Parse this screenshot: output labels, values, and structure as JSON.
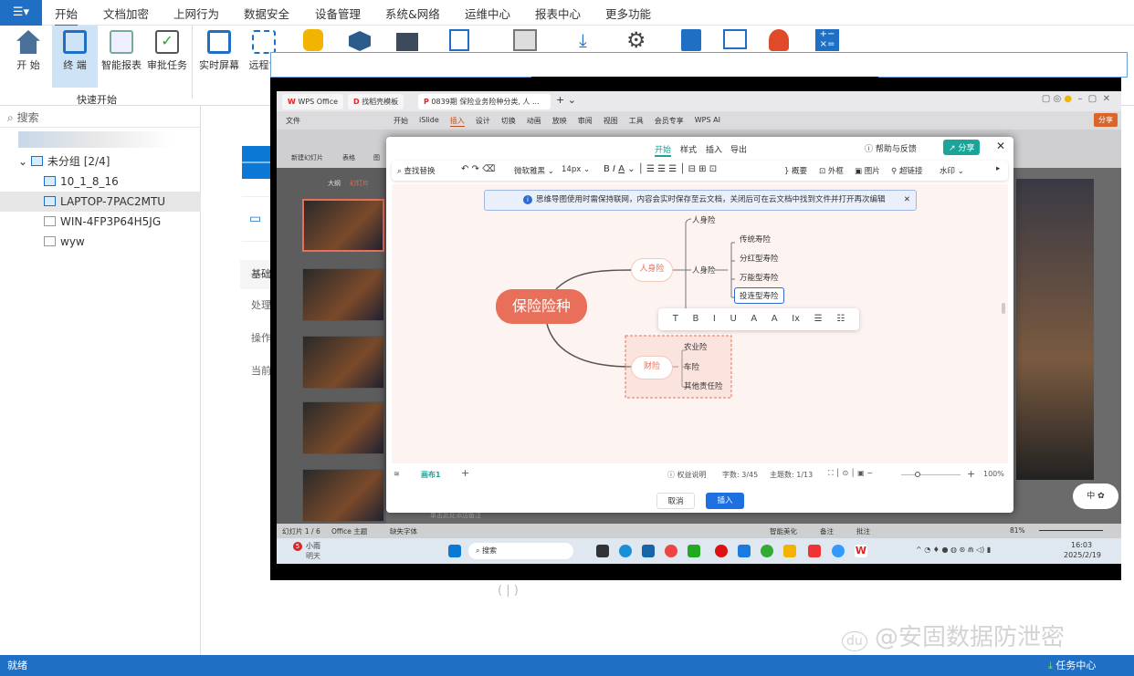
{
  "menubar": {
    "app_icon": "app-menu-icon",
    "items": [
      "开始",
      "文档加密",
      "上网行为",
      "数据安全",
      "设备管理",
      "系统&网络",
      "运维中心",
      "报表中心",
      "更多功能"
    ],
    "active": "开始"
  },
  "ribbon": {
    "buttons": [
      "开 始",
      "终 端",
      "智能报表",
      "审批任务",
      "实时屏幕",
      "远程协"
    ],
    "group_label": "快速开始"
  },
  "sidebar": {
    "search_placeholder": "搜索",
    "group": "未分组",
    "group_count": "[2/4]",
    "devices": [
      "10_1_8_16",
      "LAPTOP-7PAC2MTU",
      "WIN-4FP3P64H5JG",
      "wyw"
    ],
    "selected": "LAPTOP-7PAC2MTU"
  },
  "main_partial": {
    "labels": [
      "基础",
      "处理",
      "操作",
      "当前"
    ]
  },
  "wps": {
    "tabs": [
      "WPS Office",
      "找稻壳模板",
      "0839期 保险业务险种分类, 人 ..."
    ],
    "menu": [
      "文件",
      "开始",
      "iSlide",
      "插入",
      "设计",
      "切换",
      "动画",
      "放映",
      "审阅",
      "视图",
      "工具",
      "会员专享",
      "WPS AI"
    ],
    "active_menu": "插入",
    "share": "分享",
    "tool": [
      "新建幻灯片",
      "表格",
      "图"
    ],
    "pane_tabs": [
      "大纲",
      "幻灯片"
    ],
    "status_left": [
      "幻灯片 1 / 6",
      "Office 主题",
      "缺失字体"
    ],
    "status_right": [
      "智能美化",
      "备注",
      "批注",
      "81%"
    ],
    "note_hint": "单击此处添加备注"
  },
  "dialog": {
    "tabs": [
      "开始",
      "样式",
      "插入",
      "导出"
    ],
    "active_tab": "开始",
    "help": "帮助与反馈",
    "share": "分享",
    "toolbar": [
      "查找替换",
      "微软雅黑",
      "14px",
      "概要",
      "外框",
      "图片",
      "超链接",
      "水印"
    ],
    "notice": "思维导图使用时需保持联网，内容会实时保存至云文档，关闭后可在云文档中找到文件并打开再次编辑",
    "mindmap": {
      "root": "保险险种",
      "branches": [
        {
          "label": "人身险",
          "children": [
            "人身险",
            "人身险"
          ],
          "sub": [
            "传统寿险",
            "分红型寿险",
            "万能型寿险",
            "投连型寿险"
          ]
        },
        {
          "label": "财险",
          "children": [
            "农业险",
            "车险",
            "其他责任险"
          ]
        }
      ],
      "editing": "投连型寿险"
    },
    "format_bar": [
      "T",
      "B",
      "I",
      "U",
      "A",
      "A",
      "Ix",
      "☰",
      "☷"
    ],
    "footer": {
      "canvas_tab": "画布1",
      "rights": "权益说明",
      "word_count": "字数: 3/45",
      "topic_count": "主题数: 1/13",
      "zoom": "100%"
    },
    "cancel": "取消",
    "insert": "插入"
  },
  "taskbar": {
    "weather_title": "小雨",
    "weather_sub": "明天",
    "search": "搜索",
    "time": "16:03",
    "date": "2025/2/19",
    "badge": "5"
  },
  "statusbar": {
    "left": "就绪",
    "right": "任务中心"
  },
  "watermark": "@安固数据防泄密",
  "colors": {
    "accent": "#1f6fc5",
    "root_node": "#e8705a",
    "dialog_primary": "#1e6fe0",
    "share": "#1aa59a"
  }
}
